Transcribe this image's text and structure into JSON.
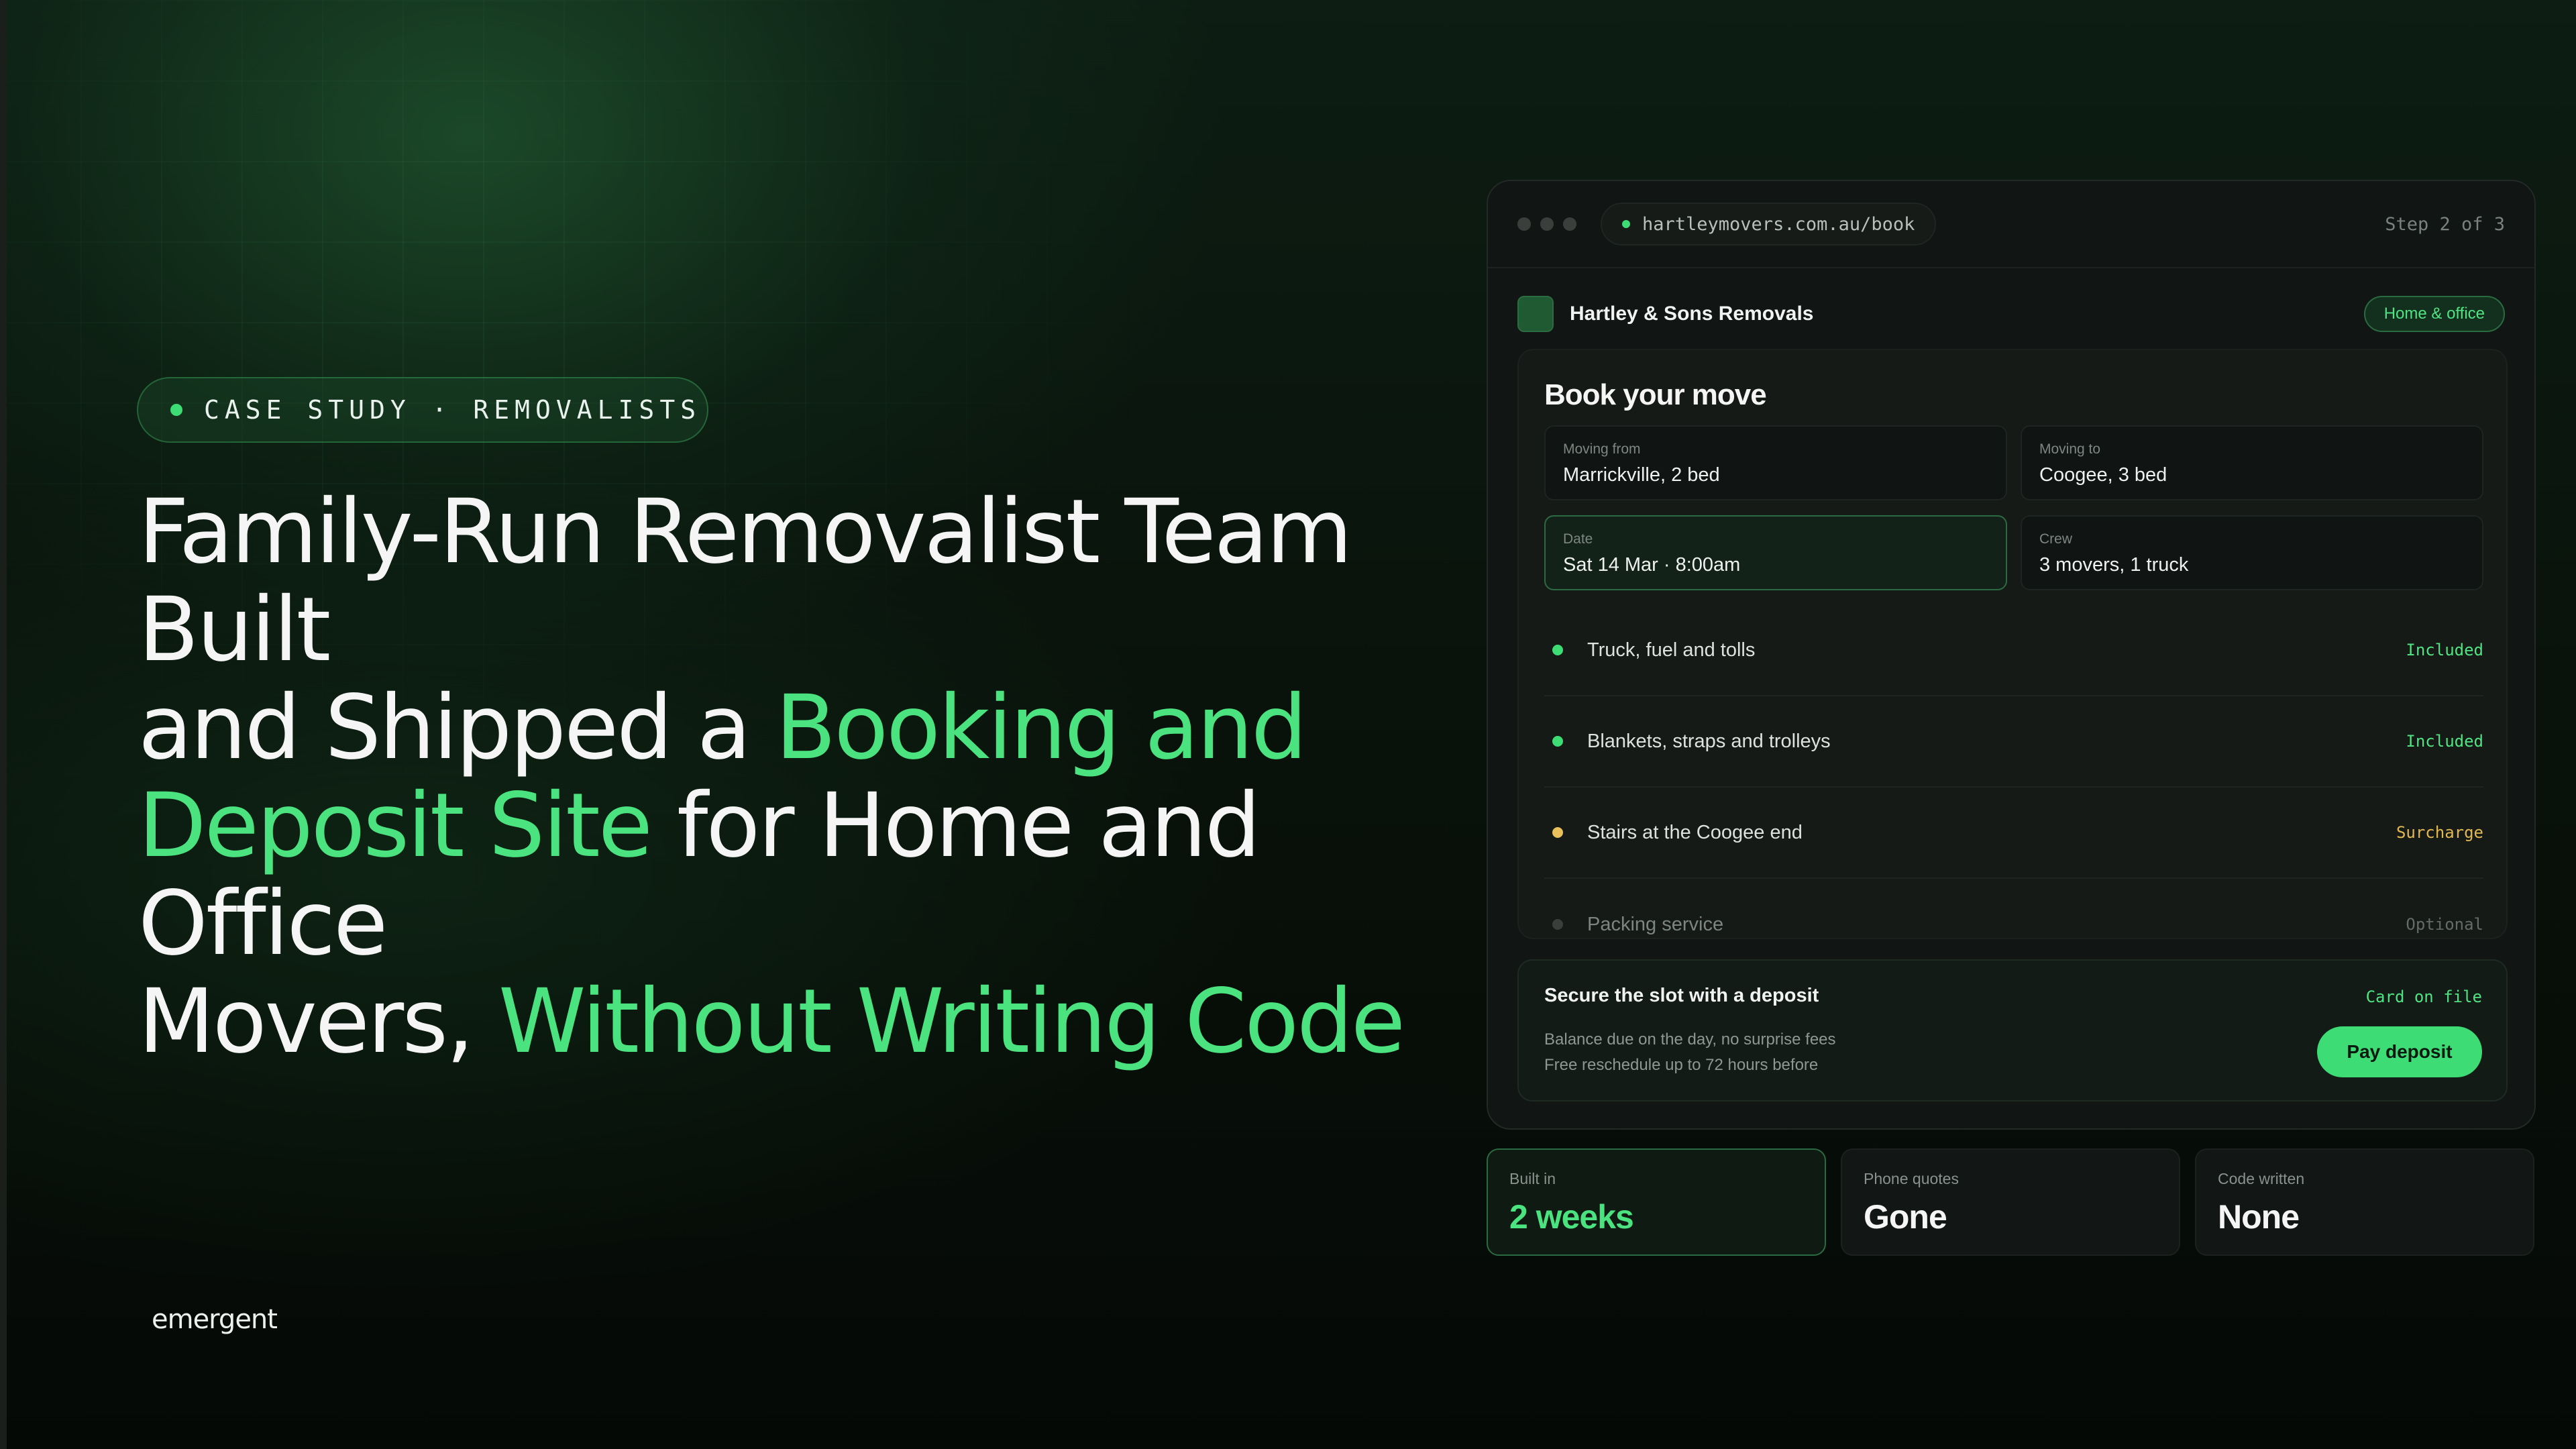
{
  "hero": {
    "eyebrow": "CASE STUDY · REMOVALISTS",
    "headline": [
      {
        "text": "Family-Run Removalist Team Built",
        "accent": false,
        "br": true
      },
      {
        "text": "and Shipped a ",
        "accent": false,
        "br": false
      },
      {
        "text": "Booking and",
        "accent": true,
        "br": true
      },
      {
        "text": "Deposit Site",
        "accent": true,
        "br": false
      },
      {
        "text": " for Home and Office",
        "accent": false,
        "br": true
      },
      {
        "text": "Movers, ",
        "accent": false,
        "br": false
      },
      {
        "text": "Without Writing Code",
        "accent": true,
        "br": false
      }
    ],
    "brand": "emergent"
  },
  "browser": {
    "url": "hartleymovers.com.au/book",
    "step": "Step 2 of 3",
    "app_name": "Hartley & Sons Removals",
    "category_pill": "Home & office",
    "form": {
      "title": "Book your move",
      "fields": [
        {
          "label": "Moving from",
          "value": "Marrickville, 2 bed"
        },
        {
          "label": "Moving to",
          "value": "Coogee, 3 bed"
        },
        {
          "label": "Date",
          "value": "Sat 14 Mar · 8:00am"
        },
        {
          "label": "Crew",
          "value": "3 movers, 1 truck"
        }
      ],
      "items": [
        {
          "name": "Truck, fuel and tolls",
          "status": "Included",
          "color": "#3ddc75",
          "status_color": "#4fe383"
        },
        {
          "name": "Blankets, straps and trolleys",
          "status": "Included",
          "color": "#3ddc75",
          "status_color": "#4fe383"
        },
        {
          "name": "Stairs at the Coogee end",
          "status": "Surcharge",
          "color": "#e8c15a",
          "status_color": "#e1b84f"
        },
        {
          "name": "Packing service",
          "status": "Optional",
          "color": "#3a3f3c",
          "status_color": "#646b68"
        }
      ]
    },
    "deposit": {
      "title": "Secure the slot with a deposit",
      "tag": "Card on file",
      "line1": "Balance due on the day, no surprise fees",
      "line2": "Free reschedule up to 72 hours before",
      "button": "Pay deposit"
    }
  },
  "stats": [
    {
      "label": "Built in",
      "value": "2 weeks"
    },
    {
      "label": "Phone quotes",
      "value": "Gone"
    },
    {
      "label": "Code written",
      "value": "None"
    }
  ],
  "colors": {
    "accent": "#4be37f",
    "background": "#07100b",
    "card": "#111513"
  }
}
